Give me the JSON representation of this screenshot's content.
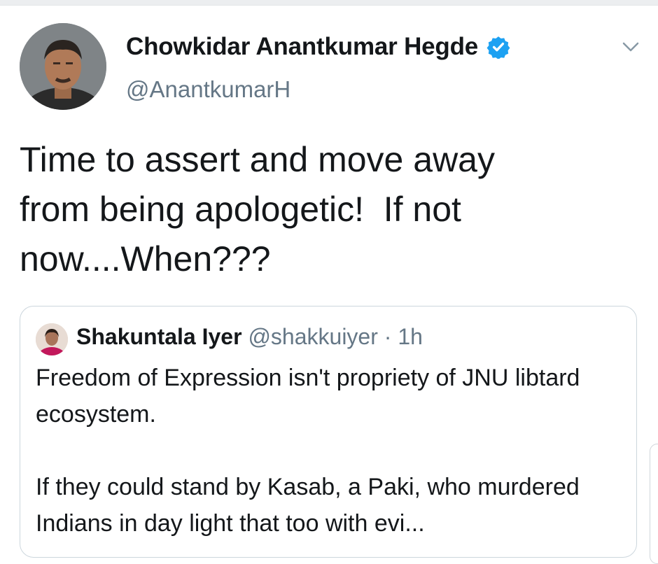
{
  "tweet": {
    "author": {
      "display_name": "Chowkidar Anantkumar Hegde",
      "handle": "@AnantkumarH",
      "verified": true,
      "avatar_icon": "profile-photo-man"
    },
    "text": "Time to assert and move away\nfrom being apologetic!  If not\nnow....When???",
    "menu_icon": "chevron-down-icon"
  },
  "quote": {
    "author": {
      "display_name": "Shakuntala Iyer",
      "handle": "@shakkuiyer",
      "separator": " · ",
      "time": "1h",
      "avatar_icon": "profile-photo-woman"
    },
    "paragraphs": [
      "Freedom of Expression isn't propriety of JNU libtard ecosystem.",
      "If they could stand by Kasab, a Paki, who murdered Indians in day light that too with evi..."
    ]
  },
  "colors": {
    "text_primary": "#14171a",
    "text_secondary": "#657786",
    "verified_blue": "#1da1f2",
    "border": "#ccd6dd"
  }
}
